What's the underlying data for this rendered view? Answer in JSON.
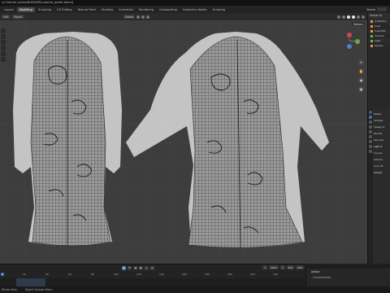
{
  "window": {
    "title": "/v:Colorful Jacket/BLENDER/colorful_jacket.blend]"
  },
  "menubar": {
    "tabs": [
      "Layout",
      "Modeling",
      "Sculpting",
      "UV Editing",
      "Texture Paint",
      "Shading",
      "Animation",
      "Rendering",
      "Compositing",
      "Geometry Nodes",
      "Scripting"
    ],
    "active_tab": "Modeling",
    "scene_label": "Scene"
  },
  "viewport_header": {
    "mode": "Edit",
    "object_menu": "Object",
    "orientation": "Global",
    "options": "Options"
  },
  "viewport": {
    "background": "#3d3d3d",
    "grid_color": "#4a4a4a",
    "garment_color": "#8a8a8a",
    "fur_color": "#c8c8c8",
    "wire_color": "#1a1a1a"
  },
  "outliner": {
    "header": "Scene Co",
    "rows": [
      "Collection",
      "Coat",
      "Coat.001",
      "Camera",
      "Light",
      "Sphere"
    ]
  },
  "properties": {
    "items": [
      "Scene",
      "Sample",
      "Viewport",
      "Render",
      "Denoise",
      "Light P",
      "Curves",
      "Volume",
      "Color M",
      "Output"
    ]
  },
  "timeline": {
    "ticks": [
      "20",
      "40",
      "60",
      "80",
      "100",
      "120",
      "140",
      "160",
      "180",
      "200",
      "220",
      "240"
    ],
    "current_frame": "1",
    "start_label": "Start",
    "start_value": "1",
    "end_label": "End",
    "end_value": "250"
  },
  "action_panel": {
    "title": "Action",
    "subtitle": "ContextAction"
  },
  "statusbar": {
    "left": "Resize View",
    "middle": "Object Context Menu"
  }
}
